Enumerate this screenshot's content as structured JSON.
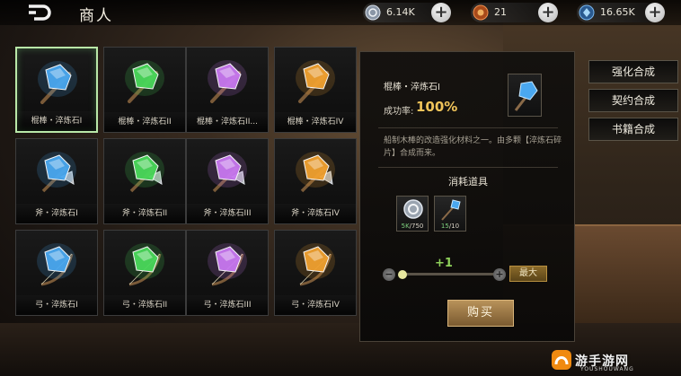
{
  "header": {
    "title": "商人",
    "currencies": [
      {
        "icon": "silver-coin-icon",
        "value": "6.14K",
        "color": "#9aa8b8"
      },
      {
        "icon": "bronze-token-icon",
        "value": "21",
        "color": "#d0662a"
      },
      {
        "icon": "blue-gem-icon",
        "value": "16.65K",
        "color": "#4a8ad0"
      }
    ]
  },
  "grid": {
    "items": [
      {
        "label": "棍棒・淬炼石I",
        "gem": "blue",
        "weapon": "club"
      },
      {
        "label": "棍棒・淬炼石II",
        "gem": "green",
        "weapon": "club"
      },
      {
        "label": "棍棒・淬炼石II...",
        "gem": "purple",
        "weapon": "club"
      },
      {
        "label": "棍棒・淬炼石IV",
        "gem": "orange",
        "weapon": "club"
      },
      {
        "label": "斧・淬炼石I",
        "gem": "blue",
        "weapon": "axe"
      },
      {
        "label": "斧・淬炼石II",
        "gem": "green",
        "weapon": "axe"
      },
      {
        "label": "斧・淬炼石III",
        "gem": "purple",
        "weapon": "axe"
      },
      {
        "label": "斧・淬炼石IV",
        "gem": "orange",
        "weapon": "axe"
      },
      {
        "label": "弓・淬炼石I",
        "gem": "blue",
        "weapon": "bow"
      },
      {
        "label": "弓・淬炼石II",
        "gem": "green",
        "weapon": "bow"
      },
      {
        "label": "弓・淬炼石III",
        "gem": "purple",
        "weapon": "bow"
      },
      {
        "label": "弓・淬炼石IV",
        "gem": "orange",
        "weapon": "bow"
      }
    ],
    "gem_colors": {
      "blue": "#4aa8f0",
      "green": "#4ad85a",
      "purple": "#c878f0",
      "orange": "#f0a030"
    }
  },
  "detail": {
    "name": "棍棒・淬炼石I",
    "rate_label": "成功率:",
    "rate_value": "100%",
    "description": "船制木棒的改造强化材料之一。由多颗【淬炼石碎片】合成而来。",
    "consume_title": "消耗道具",
    "materials": [
      {
        "icon": "silver-coin-icon",
        "have": "5K",
        "need": "750"
      },
      {
        "icon": "refine-shard-icon",
        "have": "15",
        "need": "10"
      }
    ],
    "quantity": "+1",
    "max_label": "最大",
    "buy_label": "购买"
  },
  "tabs": [
    {
      "label": "强化合成"
    },
    {
      "label": "契约合成"
    },
    {
      "label": "书籍合成"
    }
  ],
  "watermark": {
    "text": "游手游网",
    "sub": "YOUSHOUWANG"
  }
}
